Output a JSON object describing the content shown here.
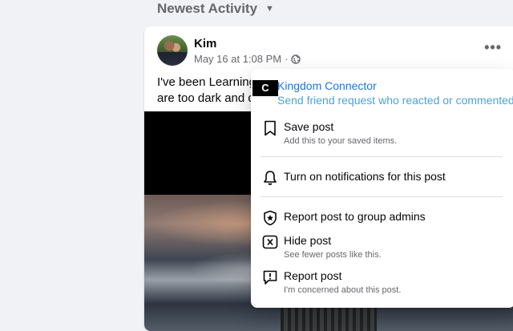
{
  "feed": {
    "sort_label": "Newest Activity",
    "sort_icon": "caret-down-icon"
  },
  "post": {
    "author": "Kim",
    "timestamp": "May 16 at 1:08 PM",
    "separator": "·",
    "privacy_icon": "globe-icon",
    "more_label": "•••",
    "text_line1": "I've been Learning",
    "text_line2": "are too dark and d"
  },
  "menu": {
    "extension": {
      "logo_text": "C",
      "title": "Kingdom Connector",
      "subtitle": "Send friend request who reacted or commented"
    },
    "items": [
      {
        "icon": "bookmark-icon",
        "label": "Save post",
        "desc": "Add this to your saved items."
      },
      {
        "icon": "bell-icon",
        "label": "Turn on notifications for this post",
        "desc": ""
      },
      {
        "icon": "shield-star-icon",
        "label": "Report post to group admins",
        "desc": ""
      },
      {
        "icon": "hide-x-icon",
        "label": "Hide post",
        "desc": "See fewer posts like this."
      },
      {
        "icon": "report-alert-icon",
        "label": "Report post",
        "desc": "I'm concerned about this post."
      }
    ]
  },
  "colors": {
    "background": "#f0f2f5",
    "link_blue": "#1b74e4",
    "light_blue": "#4aa3df",
    "secondary_text": "#65676b"
  }
}
